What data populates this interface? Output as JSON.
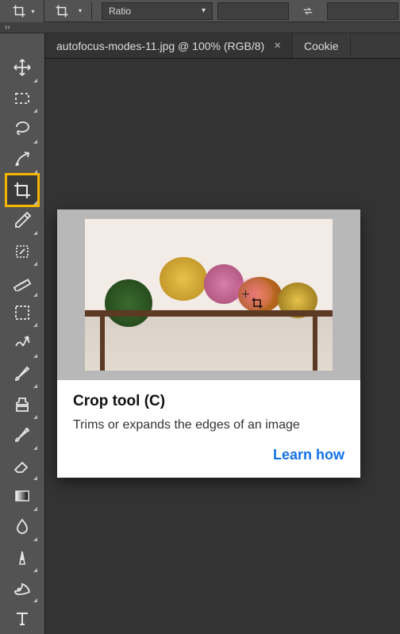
{
  "options": {
    "preset_label": "Ratio"
  },
  "tabs": {
    "active": "autofocus-modes-11.jpg @ 100% (RGB/8)",
    "second": "Cookie"
  },
  "tooltip": {
    "title": "Crop tool (C)",
    "desc": "Trims or expands the edges of an image",
    "link": "Learn how"
  },
  "tools": [
    {
      "name": "move-tool"
    },
    {
      "name": "rectangular-marquee-tool"
    },
    {
      "name": "lasso-tool"
    },
    {
      "name": "quick-selection-tool"
    },
    {
      "name": "crop-tool"
    },
    {
      "name": "eyedropper-tool"
    },
    {
      "name": "spot-healing-brush-tool"
    },
    {
      "name": "measure-tool"
    },
    {
      "name": "frame-tool"
    },
    {
      "name": "puppet-warp-tool"
    },
    {
      "name": "brush-tool"
    },
    {
      "name": "clone-stamp-tool"
    },
    {
      "name": "history-brush-tool"
    },
    {
      "name": "eraser-tool"
    },
    {
      "name": "gradient-tool"
    },
    {
      "name": "blur-tool"
    },
    {
      "name": "dodge-tool"
    },
    {
      "name": "pen-tool"
    },
    {
      "name": "type-tool"
    }
  ]
}
